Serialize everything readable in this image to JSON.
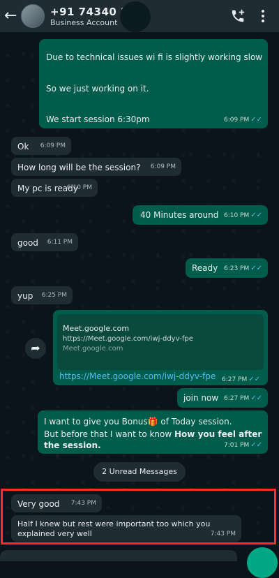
{
  "header": {
    "phone": "+91 74340 2",
    "subtitle": "Business Account"
  },
  "messages": [
    {
      "dir": "out",
      "lines": [
        "Due to technical issues wi fi is slightly working slow",
        "So we just working on it.",
        "We start session 6:30pm"
      ],
      "time": "6:09 PM",
      "ticks": "✓✓"
    },
    {
      "dir": "in",
      "text": "Ok",
      "time": "6:09 PM"
    },
    {
      "dir": "in",
      "text": "How long will be the session?",
      "time": "6:09 PM"
    },
    {
      "dir": "in",
      "text": "My pc is ready",
      "time": "6:10 PM"
    },
    {
      "dir": "out",
      "text": "40 Minutes around",
      "time": "6:10 PM",
      "ticks": "✓✓"
    },
    {
      "dir": "in",
      "text": "good",
      "time": "6:11 PM"
    },
    {
      "dir": "out",
      "text": "Ready",
      "time": "6:23 PM",
      "ticks": "✓✓"
    },
    {
      "dir": "in",
      "text": "yup",
      "time": "6:25 PM"
    },
    {
      "dir": "out",
      "type": "link",
      "preview_title": "Meet.google.com",
      "preview_url": "https://Meet.google.com/iwj-ddyv-fpe",
      "preview_host": "Meet.google.com",
      "text": "https://Meet.google.com/iwj-ddyv-fpe",
      "time": "6:27 PM",
      "ticks": "✓✓"
    },
    {
      "dir": "out",
      "text": "join now",
      "time": "6:27 PM",
      "ticks": "✓✓"
    },
    {
      "dir": "out",
      "line1": "I want to give you Bonus🎁 of Today session.",
      "line2_prefix": "But before that I want to know ",
      "line2_bold": "How you feel after",
      "line3_bold": "the session.",
      "time": "7:01 PM",
      "ticks": "✓✓"
    },
    {
      "dir": "in",
      "text": "Very good",
      "time": "7:43 PM"
    },
    {
      "dir": "in",
      "line1": "Half I knew but rest were important too which you",
      "line2": "explained very well",
      "time": "7:43 PM"
    }
  ],
  "unread_label": "2 Unread Messages",
  "icons": {
    "back": "back-arrow-icon",
    "add_call": "add-call-icon",
    "menu": "more-vert-icon",
    "share": "forward-icon"
  },
  "colors": {
    "header_bg": "#1f2c34",
    "outgoing": "#005c4b",
    "incoming": "#202c33",
    "link": "#53bdeb",
    "highlight": "#ff2a2a"
  }
}
